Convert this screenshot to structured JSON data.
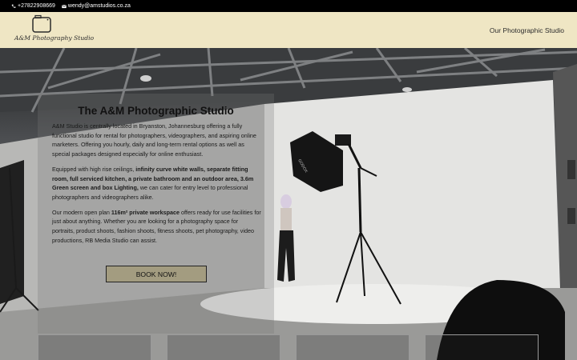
{
  "topbar": {
    "phone": "+27822908669",
    "email": "wendy@amstudios.co.za",
    "phone_icon": "phone-icon",
    "email_icon": "envelope-icon"
  },
  "header": {
    "logo_text": "A&M Photography Studio",
    "logo_icon": "camera-outline-icon",
    "nav": [
      {
        "label": "Our Photographic Studio"
      }
    ]
  },
  "hero": {
    "title": "The A&M Photographic Studio",
    "paragraph1": "A&M Studio is centrally located in Bryanston, Johannesburg offering a fully functional studio for rental for photographers, videographers, and aspiring online marketers. Offering you hourly, daily and long-term rental options as well as special packages designed especially for online enthusiast.",
    "p2_pre": "Equipped with high rise ceilings, ",
    "p2_bold": "infinity curve white walls, separate fitting room, full serviced kitchen, a private bathroom and an outdoor area, 3.6m Green screen and box Lighting,",
    "p2_post": " we can cater for entry level to professional photographers and videographers alike.",
    "p3_pre": "Our modern open plan ",
    "p3_bold": "116m² private workspace",
    "p3_post": " offers ready for use facilities for just about anything. Whether you are looking for a photography space for portraits, product shoots, fashion shoots, fitness shoots, pet photography, video productions, RB Media Studio can assist.",
    "book_button": "BOOK NOW!",
    "softbox_brand": "GODOX"
  },
  "colors": {
    "header_bg": "#efe6c4",
    "topbar_bg": "#000000",
    "button_bg": "#a39c80"
  }
}
